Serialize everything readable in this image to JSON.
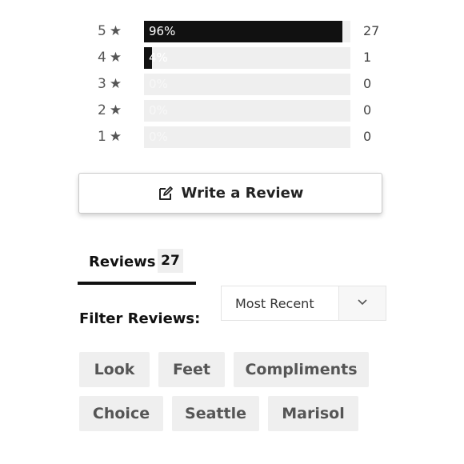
{
  "ratings": [
    {
      "stars": "5",
      "percent": 96,
      "percent_label": "96%",
      "count": "27"
    },
    {
      "stars": "4",
      "percent": 4,
      "percent_label": "4%",
      "count": "1"
    },
    {
      "stars": "3",
      "percent": 0,
      "percent_label": "0%",
      "count": "0"
    },
    {
      "stars": "2",
      "percent": 0,
      "percent_label": "0%",
      "count": "0"
    },
    {
      "stars": "1",
      "percent": 0,
      "percent_label": "0%",
      "count": "0"
    }
  ],
  "star_glyph": "★",
  "write_review": {
    "label": "Write a Review",
    "icon": "edit-icon"
  },
  "tabs": [
    {
      "label": "Reviews",
      "count": "27",
      "active": true
    }
  ],
  "filter": {
    "label": "Filter Reviews:",
    "sort_value": "Most Recent",
    "icon": "chevron-down-icon"
  },
  "keywords": [
    "Look",
    "Feet",
    "Compliments",
    "Choice",
    "Seattle",
    "Marisol"
  ],
  "colors": {
    "bar_fill": "#111111",
    "bar_track": "#efefef",
    "chip_bg": "#efefef",
    "tab_underline": "#111111"
  }
}
